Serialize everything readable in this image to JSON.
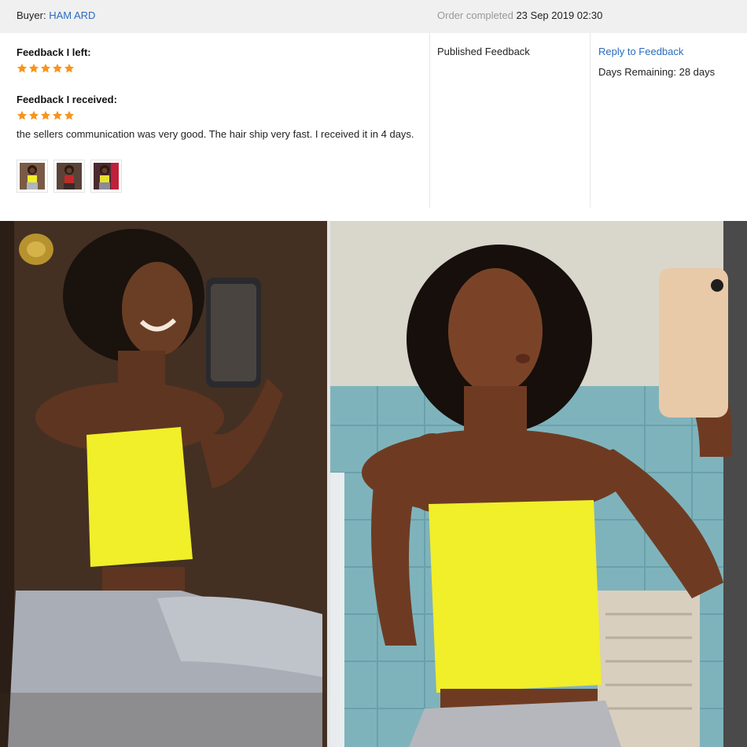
{
  "header": {
    "buyer_label": "Buyer:",
    "buyer_name": "HAM ARD",
    "order_status": "Order completed",
    "order_date": "23 Sep 2019 02:30"
  },
  "feedback_left": {
    "heading": "Feedback I left:",
    "rating": 5
  },
  "feedback_received": {
    "heading": "Feedback I received:",
    "rating": 5,
    "comment": "the sellers communication was very good. The hair ship very fast. I received it in 4 days.",
    "thumbnails": 3
  },
  "status": {
    "published": "Published Feedback"
  },
  "actions": {
    "reply_label": "Reply to Feedback",
    "days_remaining": "Days Remaining: 28 days"
  },
  "colors": {
    "link": "#2a6bbd",
    "star": "#f7941d",
    "top_yellow": "#f1ee2a"
  },
  "icons": {
    "star": "star-icon"
  }
}
